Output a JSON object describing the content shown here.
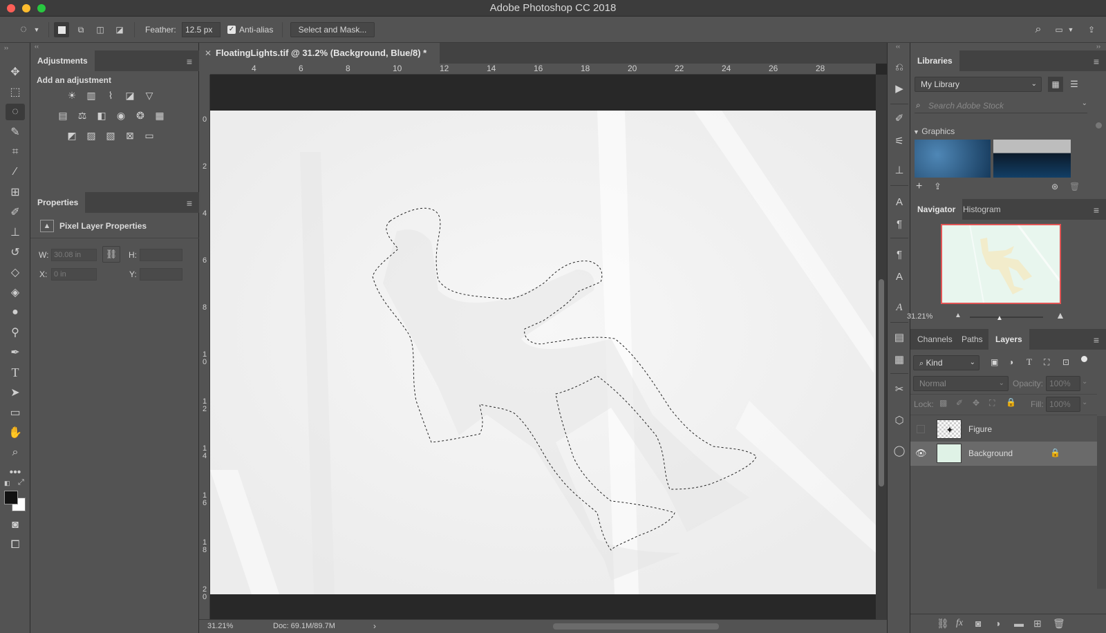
{
  "window": {
    "title": "Adobe Photoshop CC 2018"
  },
  "options_bar": {
    "feather_label": "Feather:",
    "feather_value": "12.5 px",
    "anti_alias_label": "Anti-alias",
    "anti_alias_checked": true,
    "select_and_mask_label": "Select and Mask..."
  },
  "adjustments": {
    "tab": "Adjustments",
    "hint": "Add an adjustment"
  },
  "properties": {
    "tab": "Properties",
    "layer_type": "Pixel Layer Properties",
    "w_label": "W:",
    "w_placeholder": "30.08 in",
    "h_label": "H:",
    "x_label": "X:",
    "x_placeholder": "0 in",
    "y_label": "Y:"
  },
  "document": {
    "tab_title": "FloatingLights.tif @ 31.2% (Background, Blue/8) *",
    "zoom": "31.21%",
    "doc_info": "Doc: 69.1M/89.7M",
    "ruler_top": [
      "4",
      "6",
      "8",
      "10",
      "12",
      "14",
      "16",
      "18",
      "20",
      "22",
      "24",
      "26",
      "28"
    ],
    "ruler_left": [
      "0",
      "2",
      "4",
      "6",
      "8",
      "10",
      "12",
      "14",
      "16",
      "18",
      "20"
    ]
  },
  "libraries": {
    "tab": "Libraries",
    "library": "My Library",
    "search_placeholder": "Search Adobe Stock",
    "section": "Graphics"
  },
  "navigator": {
    "tabs": [
      "Navigator",
      "Histogram"
    ],
    "zoom": "31.21%"
  },
  "layers_panel": {
    "tabs": [
      "Channels",
      "Paths",
      "Layers"
    ],
    "filter": "Kind",
    "blend_mode": "Normal",
    "opacity_label": "Opacity:",
    "opacity_value": "100%",
    "lock_label": "Lock:",
    "fill_label": "Fill:",
    "fill_value": "100%",
    "layers": [
      {
        "name": "Figure",
        "visible": false,
        "selected": false,
        "locked": false
      },
      {
        "name": "Background",
        "visible": true,
        "selected": true,
        "locked": true
      }
    ]
  },
  "colors": {
    "foreground": "#111111",
    "background": "#ffffff",
    "accent_red": "#e25555"
  }
}
